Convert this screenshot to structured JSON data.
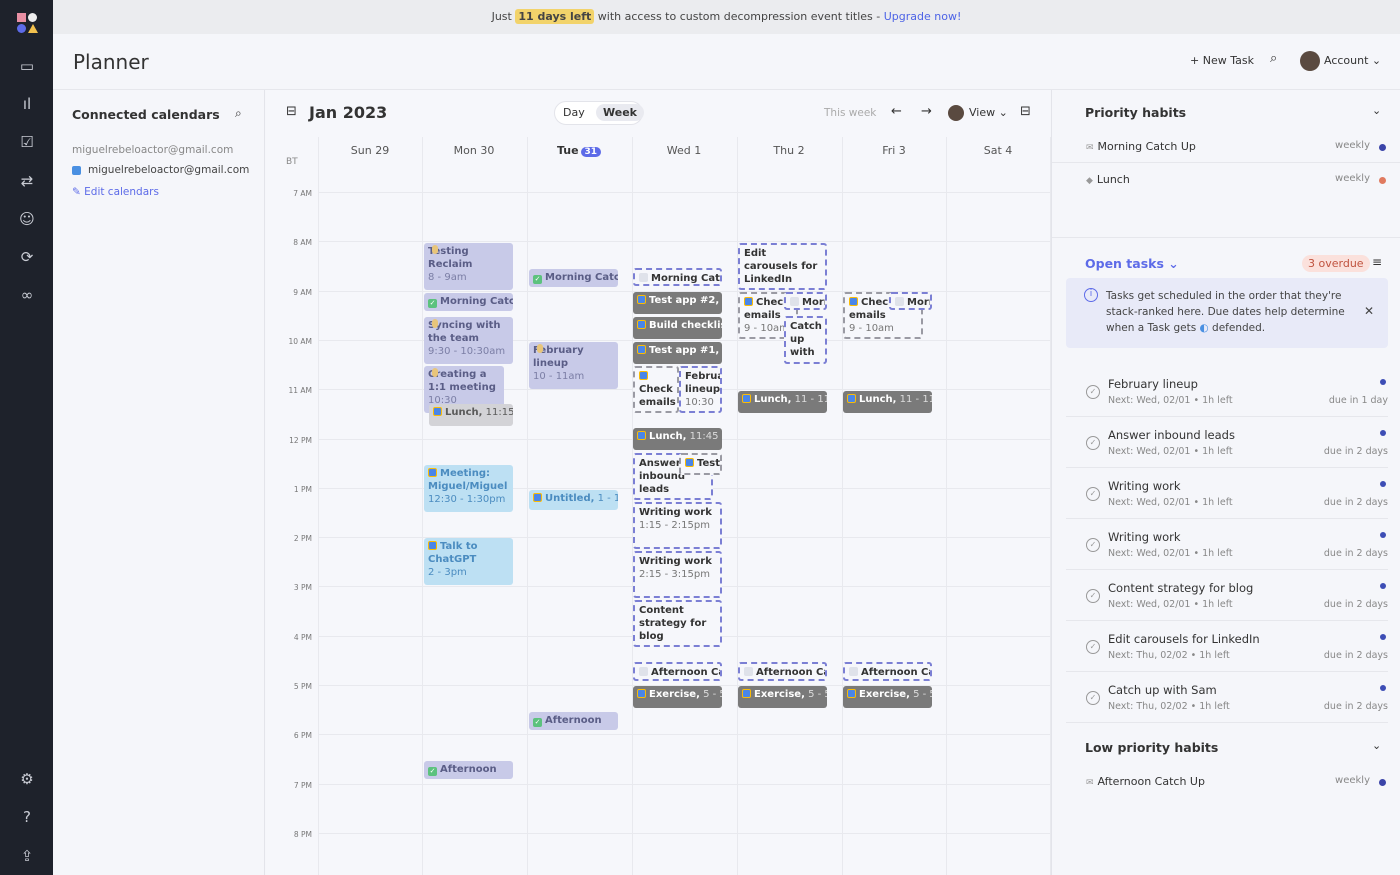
{
  "banner": {
    "pre": "Just",
    "highlight": "11 days left",
    "mid": "with access to custom decompression event titles -",
    "link": "Upgrade now!"
  },
  "header": {
    "title": "Planner",
    "new_task": "+ New Task",
    "account": "Account"
  },
  "sidebar": {
    "icons": [
      "logo",
      "calendar-icon",
      "stats-icon",
      "tasks-icon",
      "habits-icon",
      "team-icon",
      "sync-icon",
      "link-icon",
      "settings-icon",
      "help-icon",
      "share-icon"
    ]
  },
  "calendars": {
    "title": "Connected calendars",
    "account": "miguelrebeloactor@gmail.com",
    "calendar": "miguelrebeloactor@gmail.com",
    "calendar_color": "#4a90e2",
    "edit": "Edit calendars"
  },
  "calendar": {
    "month": "Jan 2023",
    "view_day": "Day",
    "view_week": "Week",
    "this_week": "This week",
    "view": "View",
    "tz": "BT",
    "days": [
      "Sun 29",
      "Mon 30",
      "Tue",
      "Wed 1",
      "Thu 2",
      "Fri 3",
      "Sat 4"
    ],
    "today_num": "31",
    "hours": [
      "7 AM",
      "8 AM",
      "9 AM",
      "10 AM",
      "11 AM",
      "12 PM",
      "1 PM",
      "2 PM",
      "3 PM",
      "4 PM",
      "5 PM",
      "6 PM",
      "7 PM",
      "8 PM"
    ],
    "events": [
      {
        "title": "Testing Reclaim",
        "time": "8 - 9am",
        "kind": "task",
        "icon": "hourglass"
      },
      {
        "title": "Morning Catch Up",
        "time": "",
        "kind": "done",
        "icon": "check"
      },
      {
        "title": "Syncing with the team",
        "time": "9:30 - 10:30am",
        "kind": "task",
        "icon": "hourglass"
      },
      {
        "title": "Creating a 1:1 meeting",
        "time": "10:30",
        "kind": "task",
        "icon": "hourglass"
      },
      {
        "title": "Lunch,",
        "time": "11:15 - 1",
        "kind": "ggray",
        "icon": "gcal"
      },
      {
        "title": "Meeting: Miguel/Miguel",
        "time": "12:30 - 1:30pm",
        "kind": "glight",
        "icon": "gcal"
      },
      {
        "title": "Talk to ChatGPT",
        "time": "2 - 3pm",
        "kind": "glight",
        "icon": "gcal"
      },
      {
        "title": "Afternoon",
        "time": "",
        "kind": "done",
        "icon": "check"
      },
      {
        "title": "Morning Catch Up",
        "time": "",
        "kind": "done",
        "icon": "check"
      },
      {
        "title": "February lineup",
        "time": "10 - 11am",
        "kind": "task",
        "icon": "hourglass"
      },
      {
        "title": "Untitled,",
        "time": "1 - 1:30",
        "kind": "glight",
        "icon": "gcal"
      },
      {
        "title": "Afternoon",
        "time": "",
        "kind": "done",
        "icon": "check"
      },
      {
        "title": "Morning Catch Up",
        "time": "",
        "kind": "dblue",
        "icon": "mail"
      },
      {
        "title": "Test app #2,",
        "time": "9",
        "kind": "dark",
        "icon": "gcal"
      },
      {
        "title": "Build checklist",
        "time": "",
        "kind": "dark",
        "icon": "gcal"
      },
      {
        "title": "Test app #1,",
        "time": "10",
        "kind": "dark",
        "icon": "gcal"
      },
      {
        "title": "Check emails",
        "time": "10:30 -",
        "kind": "dgray",
        "icon": "gcal"
      },
      {
        "title": "February lineup",
        "time": "10:30 -",
        "kind": "dblue",
        "icon": ""
      },
      {
        "title": "Lunch,",
        "time": "11:45 - 12",
        "kind": "dark",
        "icon": "gcal"
      },
      {
        "title": "Answer inbound leads",
        "time": "",
        "kind": "dblue",
        "icon": ""
      },
      {
        "title": "Test",
        "time": "",
        "kind": "dgray",
        "icon": "gcal"
      },
      {
        "title": "Writing work",
        "time": "1:15 - 2:15pm",
        "kind": "dblue",
        "icon": ""
      },
      {
        "title": "Writing work",
        "time": "2:15 - 3:15pm",
        "kind": "dblue",
        "icon": ""
      },
      {
        "title": "Content strategy for blog",
        "time": "",
        "kind": "dblue",
        "icon": ""
      },
      {
        "title": "Afternoon Catch Up",
        "time": "",
        "kind": "dblue",
        "icon": "mail"
      },
      {
        "title": "Exercise,",
        "time": "5 - 5:30",
        "kind": "dark",
        "icon": "gcal"
      },
      {
        "title": "Edit carousels for LinkedIn",
        "time": "8 - 9am",
        "kind": "dblue",
        "icon": ""
      },
      {
        "title": "Check emails",
        "time": "9 - 10am",
        "kind": "dgray",
        "icon": "gcal"
      },
      {
        "title": "Morning",
        "time": "",
        "kind": "dblue",
        "icon": "mail"
      },
      {
        "title": "Catch up with",
        "time": "",
        "kind": "dblue",
        "icon": ""
      },
      {
        "title": "Lunch,",
        "time": "11 - 11:30",
        "kind": "dark",
        "icon": "gcal"
      },
      {
        "title": "Afternoon Catch Up",
        "time": "",
        "kind": "dblue",
        "icon": "mail"
      },
      {
        "title": "Exercise,",
        "time": "5 - 5:30",
        "kind": "dark",
        "icon": "gcal"
      },
      {
        "title": "Check emails",
        "time": "9 - 10am",
        "kind": "dgray",
        "icon": "gcal"
      },
      {
        "title": "Morning",
        "time": "",
        "kind": "dblue",
        "icon": "mail"
      },
      {
        "title": "Lunch,",
        "time": "11 - 11:30",
        "kind": "dark",
        "icon": "gcal"
      },
      {
        "title": "Afternoon Catch Up",
        "time": "",
        "kind": "dblue",
        "icon": "mail"
      },
      {
        "title": "Exercise,",
        "time": "5 - 5:30",
        "kind": "dark",
        "icon": "gcal"
      }
    ]
  },
  "priority_habits": {
    "title": "Priority habits",
    "items": [
      {
        "name": "Morning Catch Up",
        "freq": "weekly",
        "color": "#3b44a8"
      },
      {
        "name": "Lunch",
        "freq": "weekly",
        "color": "#e07a5f"
      }
    ]
  },
  "open_tasks": {
    "title": "Open tasks",
    "overdue": "3 overdue",
    "info": "Tasks get scheduled in the order that they're stack-ranked here. Due dates help determine when a Task gets",
    "info_end": "defended.",
    "items": [
      {
        "title": "February lineup",
        "next": "Next: Wed, 02/01 • 1h left",
        "due": "due in 1 day"
      },
      {
        "title": "Answer inbound leads",
        "next": "Next: Wed, 02/01 • 1h left",
        "due": "due in 2 days"
      },
      {
        "title": "Writing work",
        "next": "Next: Wed, 02/01 • 1h left",
        "due": "due in 2 days"
      },
      {
        "title": "Writing work",
        "next": "Next: Wed, 02/01 • 1h left",
        "due": "due in 2 days"
      },
      {
        "title": "Content strategy for blog",
        "next": "Next: Wed, 02/01 • 1h left",
        "due": "due in 2 days"
      },
      {
        "title": "Edit carousels for LinkedIn",
        "next": "Next: Thu, 02/02 • 1h left",
        "due": "due in 2 days"
      },
      {
        "title": "Catch up with Sam",
        "next": "Next: Thu, 02/02 • 1h left",
        "due": "due in 2 days"
      }
    ]
  },
  "low_habits": {
    "title": "Low priority habits",
    "items": [
      {
        "name": "Afternoon Catch Up",
        "freq": "weekly",
        "color": "#3b44a8"
      }
    ]
  }
}
